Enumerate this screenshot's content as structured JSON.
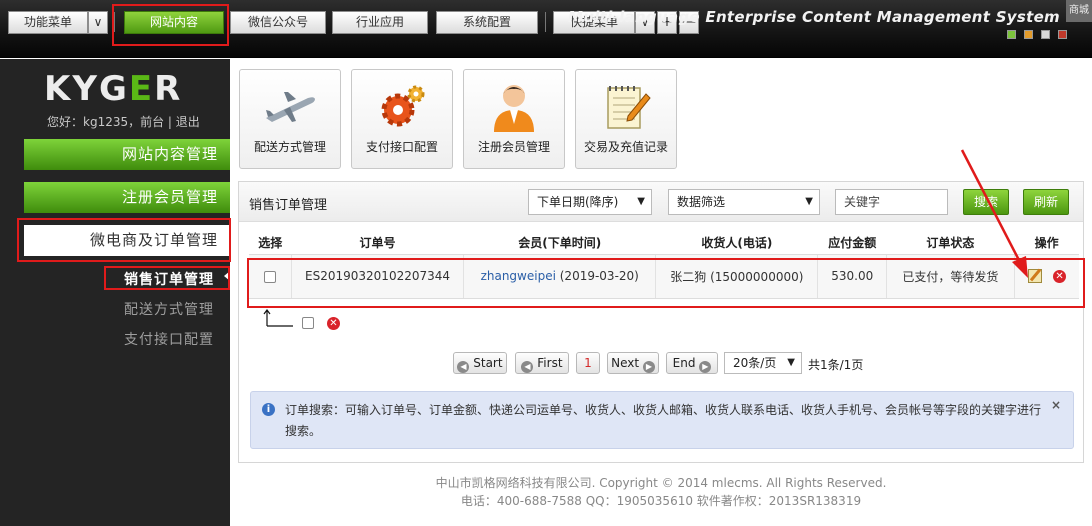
{
  "topbar": {
    "menu_label": "功能菜单",
    "tabs": [
      "网站内容",
      "微信公众号",
      "行业应用",
      "系统配置"
    ],
    "quick_menu": "快捷菜单",
    "plus": "+",
    "minus": "—",
    "system_title": "Multi-language Enterprise Content Management System",
    "corner_tag": "商城",
    "colors": {
      "active_tab": "#5aa91a",
      "highlight": "#e01b1b"
    }
  },
  "sidebar": {
    "logo_left": "KYG",
    "logo_mid": "E",
    "logo_right": "R",
    "welcome": "您好：kg1235，前台 | 退出",
    "main_items": [
      "网站内容管理",
      "注册会员管理",
      "微电商及订单管理"
    ],
    "sub_items": [
      "销售订单管理",
      "配送方式管理",
      "支付接口配置"
    ]
  },
  "shortcuts": [
    {
      "label": "配送方式管理",
      "icon": "airplane-icon"
    },
    {
      "label": "支付接口配置",
      "icon": "gear-icon"
    },
    {
      "label": "注册会员管理",
      "icon": "user-icon"
    },
    {
      "label": "交易及充值记录",
      "icon": "notepad-icon"
    }
  ],
  "panel": {
    "title": "销售订单管理",
    "sort_select": "下单日期(降序)",
    "filter_select": "数据筛选",
    "keyword_placeholder": "关键字",
    "search_btn": "搜索",
    "refresh_btn": "刷新",
    "columns": [
      "选择",
      "订单号",
      "会员(下单时间)",
      "收货人(电话)",
      "应付金额",
      "订单状态",
      "操作"
    ],
    "rows": [
      {
        "order_no": "ES20190320102207344",
        "member": "zhangweipei",
        "order_time": "(2019-03-20)",
        "receiver": "张二狗 (15000000000)",
        "amount": "530.00",
        "status": "已支付，等待发货"
      }
    ]
  },
  "pagination": {
    "start": "Start",
    "first": "First",
    "current": "1",
    "next": "Next",
    "end": "End",
    "per_page": "20条/页",
    "summary": "共1条/1页"
  },
  "info": {
    "text": "订单搜索：可输入订单号、订单金额、快递公司运单号、收货人、收货人邮箱、收货人联系电话、收货人手机号、会员帐号等字段的关键字进行搜索。",
    "close": "×"
  },
  "footer": {
    "line1": "中山市凯格网络科技有限公司. Copyright © 2014 mlecms. All Rights Reserved.",
    "line2": "电话：400-688-7588  QQ：1905035610  软件著作权：2013SR138319"
  }
}
